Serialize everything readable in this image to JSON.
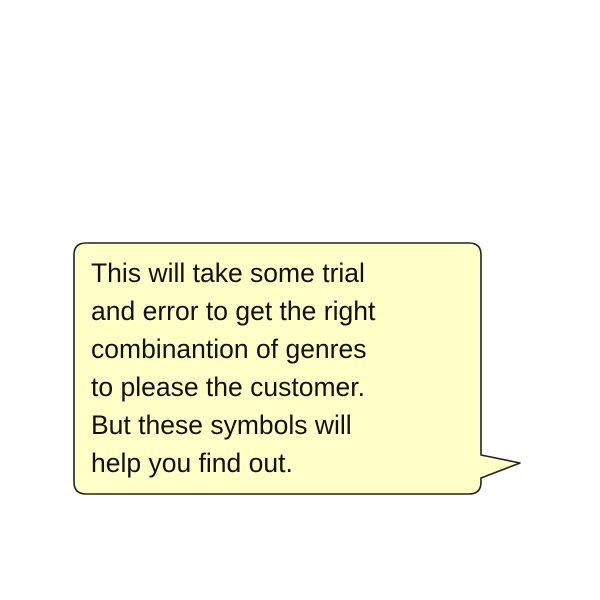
{
  "dialog": {
    "text": "This will take some trial\nand error to get the right\ncombinantion of genres\nto please the customer.\nBut these symbols will\nhelp you find out.",
    "fill_color": "#ffffc8",
    "border_color": "#222222"
  }
}
